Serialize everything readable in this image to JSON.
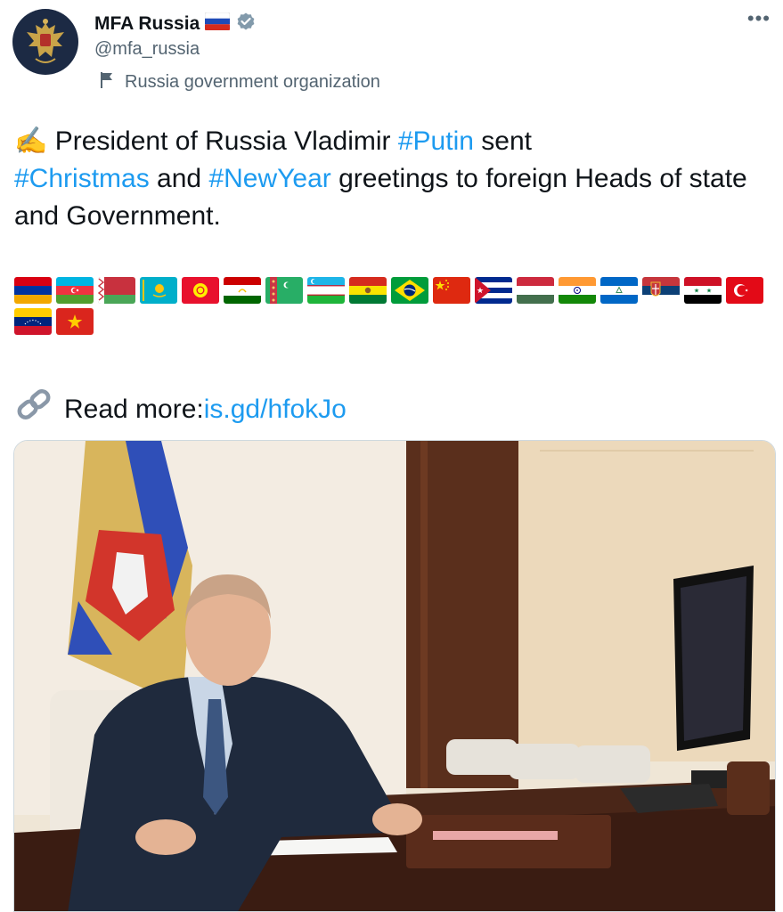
{
  "account": {
    "display_name": "MFA Russia",
    "handle": "@mfa_russia",
    "label": "Russia government organization",
    "country_flag_icon": "flag-russia-icon",
    "verified_icon": "verified-badge-icon"
  },
  "menu": {
    "more_label": "•••"
  },
  "tweet": {
    "emoji": "✍️",
    "text_1": "President of Russia Vladimir ",
    "tag_putin": "#Putin",
    "text_2": " sent",
    "tag_christmas": "#Christmas",
    "text_3": " and ",
    "tag_newyear": "#NewYear",
    "text_4": " greetings to foreign Heads of state and Government."
  },
  "flags": [
    "flag-armenia",
    "flag-azerbaijan",
    "flag-belarus",
    "flag-kazakhstan",
    "flag-kyrgyzstan",
    "flag-tajikistan",
    "flag-turkmenistan",
    "flag-uzbekistan",
    "flag-bolivia",
    "flag-brazil",
    "flag-china",
    "flag-cuba",
    "flag-hungary",
    "flag-india",
    "flag-nicaragua",
    "flag-serbia",
    "flag-syria",
    "flag-turkey",
    "flag-venezuela",
    "flag-vietnam"
  ],
  "read_more": {
    "icon": "link-icon",
    "label": "Read more: ",
    "url": "is.gd/hfokJo"
  },
  "colors": {
    "link": "#1d9bf0",
    "secondary_text": "#536471"
  }
}
